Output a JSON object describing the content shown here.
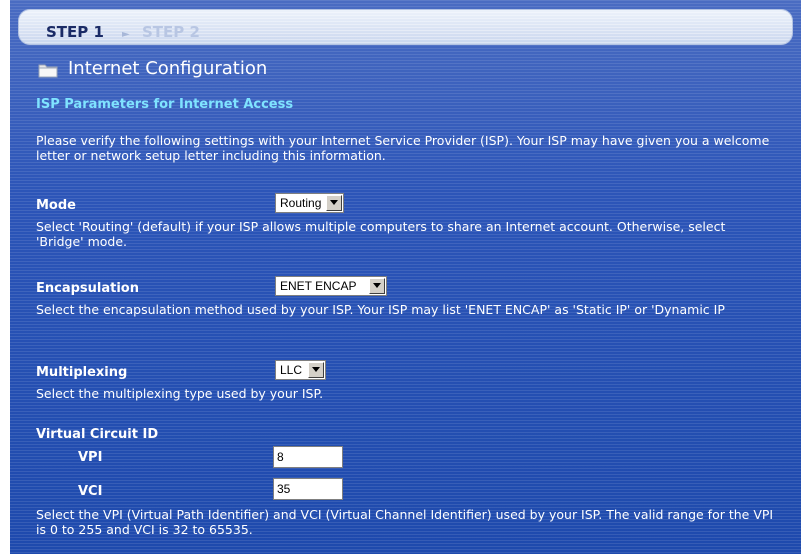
{
  "steps": [
    "STEP 1",
    "STEP 2"
  ],
  "page_title": "Internet Configuration",
  "section_title": "ISP Parameters for Internet Access",
  "intro": "Please verify the following settings with your Internet Service Provider (ISP). Your ISP may have given you a welcome letter or network setup letter including this information.",
  "mode": {
    "label": "Mode",
    "value": "Routing",
    "help": "Select 'Routing' (default) if your ISP allows multiple computers to share an Internet account. Otherwise, select 'Bridge' mode."
  },
  "encapsulation": {
    "label": "Encapsulation",
    "value": "ENET ENCAP",
    "help": "Select the encapsulation method used by your ISP. Your ISP may list 'ENET ENCAP' as 'Static IP' or 'Dynamic IP"
  },
  "multiplexing": {
    "label": "Multiplexing",
    "value": "LLC",
    "help": "Select the multiplexing type used by your ISP."
  },
  "virtual_circuit": {
    "label": "Virtual Circuit ID",
    "vpi_label": "VPI",
    "vpi_value": "8",
    "vci_label": "VCI",
    "vci_value": "35",
    "help": "Select the VPI (Virtual Path Identifier) and VCI (Virtual Channel Identifier) used by your ISP. The valid range for the VPI is 0 to 255 and VCI is 32 to 65535."
  },
  "colors": {
    "background": "#2c55b8",
    "section_title": "#7fe3ff",
    "step_active": "#1b2b66",
    "step_inactive": "#b8c6e3"
  },
  "icons": [
    "folder-icon",
    "chevron-right-icon",
    "dropdown-arrow-icon"
  ]
}
